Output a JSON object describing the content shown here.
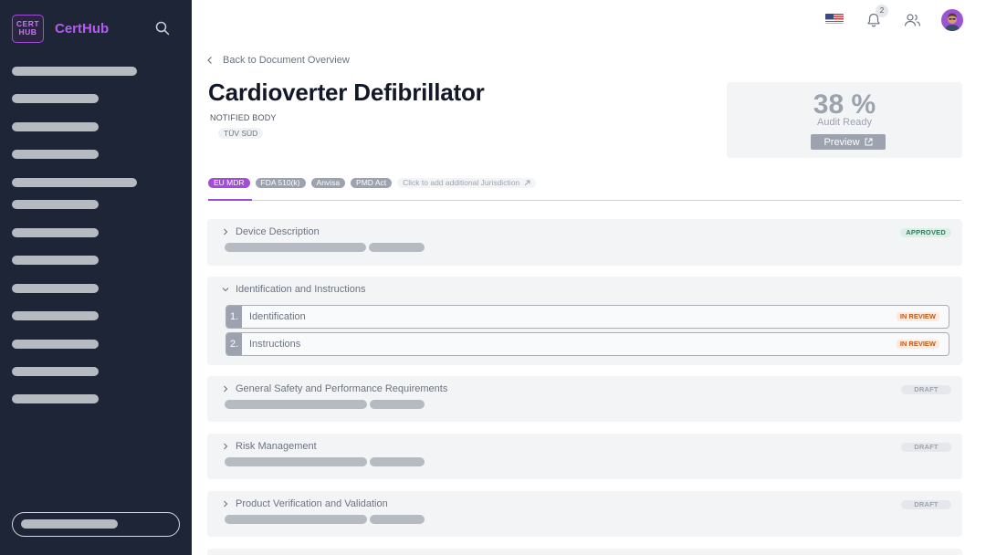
{
  "app": {
    "logo_text": "CERT HUB",
    "name": "CertHub"
  },
  "header": {
    "notification_count": "2",
    "language": "US flag"
  },
  "back_link": "Back to Document Overview",
  "document": {
    "title": "Cardioverter Defibrillator",
    "notified_body_label": "NOTIFIED BODY",
    "notified_body_value": "TÜV SÜD"
  },
  "audit": {
    "percent": "38 %",
    "label": "Audit Ready",
    "preview_label": "Preview"
  },
  "tabs": {
    "eu_mdr": "EU MDR",
    "fda": "FDA 510(k)",
    "anvisa": "Anvisa",
    "pmd": "PMD Act",
    "add": "Click to add additional Jurisdiction"
  },
  "sections": {
    "device_description": {
      "title": "Device Description",
      "status": "APPROVED"
    },
    "identification": {
      "title": "Identification and Instructions",
      "items": [
        {
          "num": "1.",
          "label": "Identification",
          "status": "IN REVIEW"
        },
        {
          "num": "2.",
          "label": "Instructions",
          "status": "IN REVIEW"
        }
      ]
    },
    "gspr": {
      "title": "General Safety and Performance Requirements",
      "status": "DRAFT"
    },
    "risk": {
      "title": "Risk Management",
      "status": "DRAFT"
    },
    "verification": {
      "title": "Product Verification and Validation",
      "status": "DRAFT"
    }
  },
  "colors": {
    "brand": "#a24dd8",
    "sidebar": "#1e2536",
    "approved": "#2f7a5a",
    "in_review": "#b85c1f"
  },
  "icons": [
    "search-icon",
    "bell-icon",
    "users-icon",
    "chevron-left-icon",
    "chevron-right-icon",
    "chevron-down-icon",
    "external-link-icon",
    "arrow-up-right-icon"
  ]
}
